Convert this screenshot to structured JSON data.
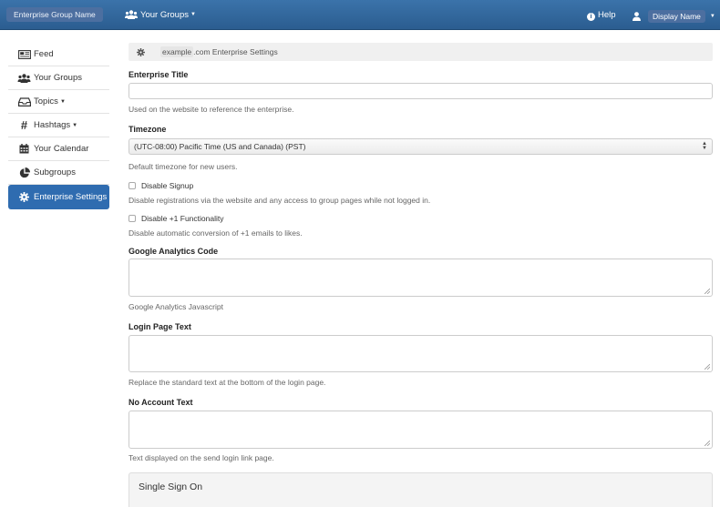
{
  "navbar": {
    "brand": "Enterprise Group Name",
    "groups_menu": "Your Groups",
    "help": "Help",
    "help_icon": "info-circle-icon",
    "user_name": "Display Name"
  },
  "sidebar": {
    "items": [
      {
        "label": "Feed",
        "icon": "newspaper-icon"
      },
      {
        "label": "Your Groups",
        "icon": "users-icon"
      },
      {
        "label": "Topics",
        "icon": "inbox-icon"
      },
      {
        "label": "Hashtags",
        "icon": "hashtag-icon"
      },
      {
        "label": "Your Calendar",
        "icon": "calendar-icon"
      },
      {
        "label": "Subgroups",
        "icon": "pie-chart-icon"
      },
      {
        "label": "Enterprise Settings",
        "icon": "gear-icon"
      }
    ],
    "active_color": "#2f6cb0"
  },
  "settings": {
    "breadcrumb_domain": "example",
    "breadcrumb_rest": ".com Enterprise Settings",
    "enterprise_title": {
      "label": "Enterprise Title",
      "value": "",
      "help": "Used on the website to reference the enterprise."
    },
    "timezone": {
      "label": "Timezone",
      "value": "(UTC-08:00) Pacific Time (US and Canada) (PST)",
      "help": "Default timezone for new users."
    },
    "disable_signup": {
      "label": "Disable Signup",
      "checked": false,
      "help": "Disable registrations via the website and any access to group pages while not logged in."
    },
    "disable_plus_one": {
      "label": "Disable +1 Functionality",
      "checked": false,
      "help": "Disable automatic conversion of +1 emails to likes."
    },
    "google_analytics": {
      "label": "Google Analytics Code",
      "value": "",
      "help": "Google Analytics Javascript"
    },
    "login_page_text": {
      "label": "Login Page Text",
      "value": "",
      "help": "Replace the standard text at the bottom of the login page."
    },
    "no_account_text": {
      "label": "No Account Text",
      "value": "",
      "help": "Text displayed on the send login link page."
    },
    "sso_title": "Single Sign On"
  },
  "colors": {
    "navbar": "#2b5d90",
    "accent": "#2f6cb0"
  }
}
